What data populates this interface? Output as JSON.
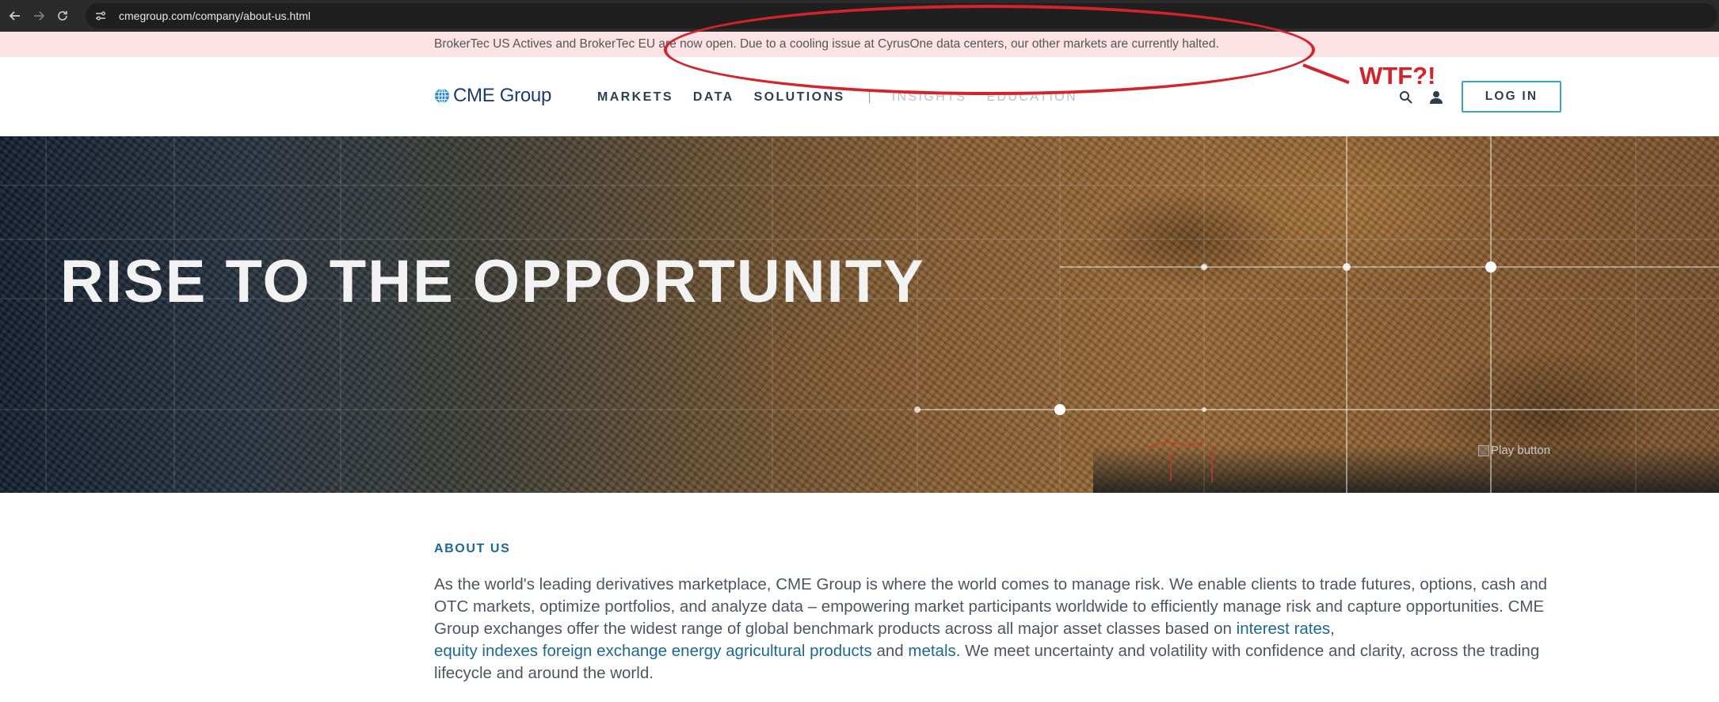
{
  "browser": {
    "url": "cmegroup.com/company/about-us.html",
    "back_icon": "arrow-left-icon",
    "forward_icon": "arrow-right-icon",
    "reload_icon": "reload-icon",
    "site_info_icon": "tune-icon"
  },
  "alert": {
    "text": "BrokerTec US Actives and BrokerTec EU are now open. Due to a cooling issue at CyrusOne data centers, our other markets are currently halted."
  },
  "header": {
    "logo_text": "CME Group",
    "nav": [
      {
        "label": "MARKETS"
      },
      {
        "label": "DATA"
      },
      {
        "label": "SOLUTIONS"
      },
      {
        "label": "INSIGHTS"
      },
      {
        "label": "EDUCATION"
      }
    ],
    "separator": "|",
    "search_icon": "search-icon",
    "user_icon": "user-icon",
    "login_label": "LOG IN"
  },
  "annotation": {
    "text": "WTF?!",
    "color": "#d4232b"
  },
  "hero": {
    "title": "RISE TO THE OPPORTUNITY",
    "play_alt": "Play button"
  },
  "about": {
    "label": "ABOUT US",
    "text_1": "As the world's leading derivatives marketplace, CME Group is where the world comes to manage risk. We enable clients to trade futures, options, cash and OTC markets, optimize portfolios, and analyze data – empowering market participants worldwide to efficiently manage risk and capture opportunities. CME Group exchanges offer the widest range of global benchmark products across all major asset classes based on ",
    "link_interest_rates": "interest rates",
    "comma": ",",
    "link_equity_indexes": "equity indexes",
    "link_foreign_exchange": "foreign exchange",
    "link_energy": "energy",
    "link_agricultural": "agricultural products",
    "and": "and",
    "link_metals": "metals",
    "text_2": ". We meet uncertainty and volatility with confidence and clarity, across the trading lifecycle and around the world."
  },
  "colors": {
    "alert_bg": "#fde3e5",
    "brand_navy": "#1d3c6e",
    "link_blue": "#1a6a8f",
    "login_border": "#3aa6b9"
  }
}
